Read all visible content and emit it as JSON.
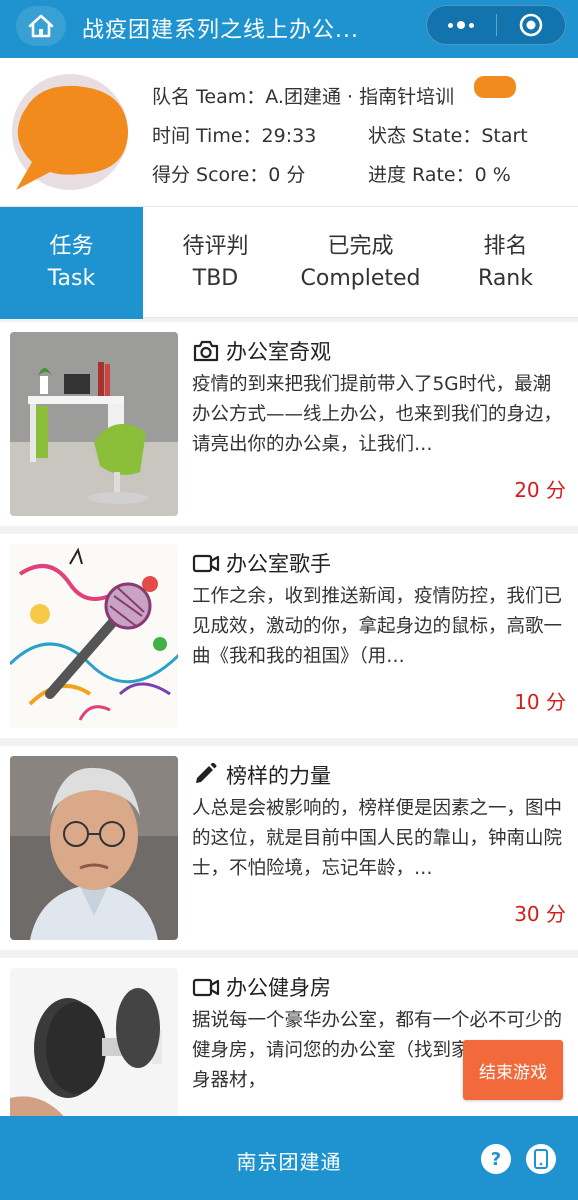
{
  "header": {
    "title": "战疫团建系列之线上办公...",
    "home_icon": "home-icon",
    "menu_icon": "more-dots-icon",
    "close_icon": "target-close-icon"
  },
  "team": {
    "name_label": "队名 Team：",
    "name_value": "A.团建通 · 指南针培训",
    "time_label": "时间 Time：",
    "time_value": "29:33",
    "state_label": "状态 State：",
    "state_value": "Start",
    "score_label": "得分 Score：",
    "score_value": "0 分",
    "rate_label": "进度 Rate：",
    "rate_value": "0 %"
  },
  "tabs": [
    {
      "cn": "任务",
      "en": "Task",
      "active": true
    },
    {
      "cn": "待评判",
      "en": "TBD",
      "active": false
    },
    {
      "cn": "已完成",
      "en": "Completed",
      "active": false
    },
    {
      "cn": "排名",
      "en": "Rank",
      "active": false
    }
  ],
  "tasks": [
    {
      "icon": "camera-icon",
      "title": "办公室奇观",
      "desc": "疫情的到来把我们提前带入了5G时代，最潮办公方式——线上办公，也来到我们的身边，请亮出你的办公桌，让我们…",
      "score": "20 分"
    },
    {
      "icon": "video-icon",
      "title": "办公室歌手",
      "desc": "工作之余，收到推送新闻，疫情防控，我们已见成效，激动的你，拿起身边的鼠标，高歌一曲《我和我的祖国》（用…",
      "score": "10 分"
    },
    {
      "icon": "pencil-icon",
      "title": "榜样的力量",
      "desc": "人总是会被影响的，榜样便是因素之一，图中的这位，就是目前中国人民的靠山，钟南山院士，不怕险境，忘记年龄，…",
      "score": "30 分"
    },
    {
      "icon": "video-icon",
      "title": "办公健身房",
      "desc": "据说每一个豪华办公室，都有一个必不可少的健身房，请问您的办公室（找到家里的一种健身器材，",
      "score": ""
    }
  ],
  "end_button": "结束游戏",
  "footer": {
    "text": "南京团建通",
    "help_icon": "question-icon",
    "phone_icon": "phone-icon"
  },
  "colors": {
    "primary": "#1e93cf",
    "score": "#d71c1c",
    "end_button": "#f26a3b",
    "redaction": "#f28b1e"
  }
}
